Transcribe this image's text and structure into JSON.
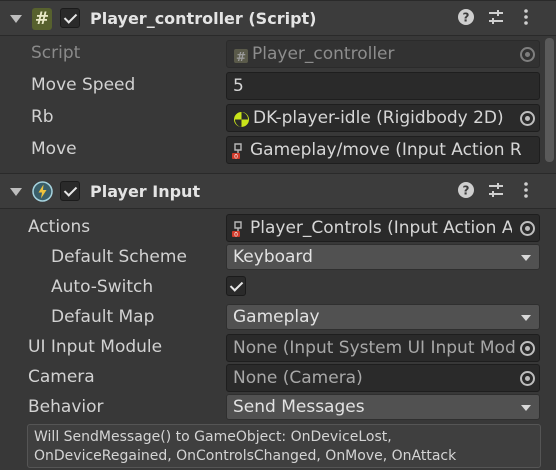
{
  "player_controller": {
    "title": "Player_controller (Script)",
    "enabled": true,
    "rows": {
      "script": {
        "label": "Script",
        "value": "Player_controller"
      },
      "move_speed": {
        "label": "Move Speed",
        "value": "5"
      },
      "rb": {
        "label": "Rb",
        "value": "DK-player-idle (Rigidbody 2D)"
      },
      "move": {
        "label": "Move",
        "value": "Gameplay/move (Input Action R"
      }
    }
  },
  "player_input": {
    "title": "Player Input",
    "enabled": true,
    "rows": {
      "actions": {
        "label": "Actions",
        "value": "Player_Controls (Input Action A"
      },
      "default_scheme": {
        "label": "Default Scheme",
        "value": "Keyboard"
      },
      "auto_switch": {
        "label": "Auto-Switch",
        "checked": true
      },
      "default_map": {
        "label": "Default Map",
        "value": "Gameplay"
      },
      "ui_input_module": {
        "label": "UI Input Module",
        "value": "None (Input System UI Input Mod"
      },
      "camera": {
        "label": "Camera",
        "value": "None (Camera)"
      },
      "behavior": {
        "label": "Behavior",
        "value": "Send Messages"
      }
    },
    "help_line1": "Will SendMessage() to GameObject: OnDeviceLost,",
    "help_line2": "OnDeviceRegained, OnControlsChanged, OnMove, OnAttack"
  },
  "colors": {
    "panel_bg": "#383838",
    "field_bg": "#2a2a2a",
    "dropdown_bg": "#515151",
    "rigidbody_icon": "#c9e41a"
  },
  "icons": [
    "foldout-arrow",
    "script-hash-icon",
    "help-icon",
    "preset-sliders-icon",
    "kebab-menu-icon",
    "object-picker-icon",
    "rigidbody-icon",
    "input-action-icon",
    "player-input-icon",
    "dropdown-arrow"
  ]
}
